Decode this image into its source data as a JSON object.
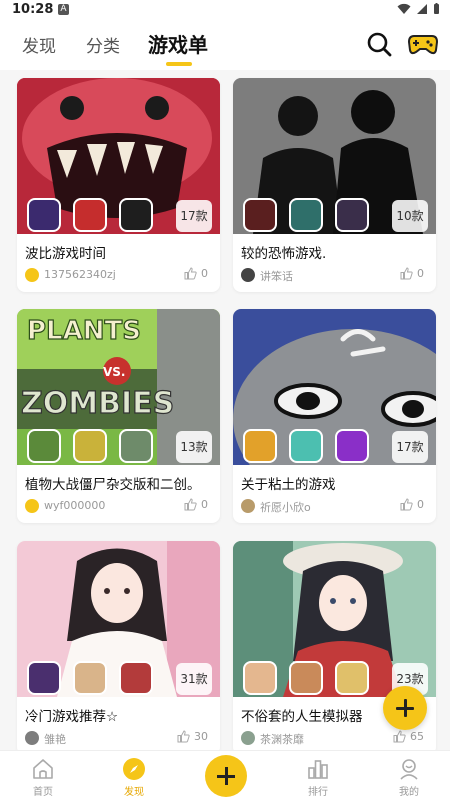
{
  "status": {
    "time": "10:28",
    "notif": "A"
  },
  "tabs": [
    {
      "label": "发现"
    },
    {
      "label": "分类"
    },
    {
      "label": "游戏单",
      "active": true
    }
  ],
  "colors": {
    "accent": "#f5c518",
    "active_nav": "#e6a700"
  },
  "cards": [
    {
      "title": "波比游戏时间",
      "count": "17款",
      "user": "137562340zj",
      "likes": "0",
      "cover_icon": "monster-cover"
    },
    {
      "title": "较的恐怖游戏.",
      "count": "10款",
      "user": "讲笨话",
      "likes": "0",
      "cover_icon": "silhouette-cover"
    },
    {
      "title": "植物大战僵尸杂交版和二创。",
      "count": "13款",
      "user": "wyf000000",
      "likes": "0",
      "cover_icon": "plants-vs-zombies-cover"
    },
    {
      "title": "关于粘土的游戏",
      "count": "17款",
      "user": "祈愿小欣o",
      "likes": "0",
      "cover_icon": "clay-creature-cover"
    },
    {
      "title": "冷门游戏推荐☆",
      "count": "31款",
      "user": "雏艳",
      "likes": "30",
      "cover_icon": "anime-girl-cover"
    },
    {
      "title": "不俗套的人生模拟器",
      "count": "23款",
      "user": "茶渊茶靡",
      "likes": "65",
      "cover_icon": "anime-girl-hat-cover"
    }
  ],
  "cover_text": {
    "plants": "PLANTS",
    "vs": "VS.",
    "zombies": "ZOMBIES"
  },
  "nav": [
    {
      "label": "首页",
      "icon": "home-icon"
    },
    {
      "label": "发现",
      "icon": "discover-icon",
      "active": true
    },
    {
      "label": "",
      "icon": "plus-icon"
    },
    {
      "label": "排行",
      "icon": "ranking-icon"
    },
    {
      "label": "我的",
      "icon": "profile-icon"
    }
  ]
}
